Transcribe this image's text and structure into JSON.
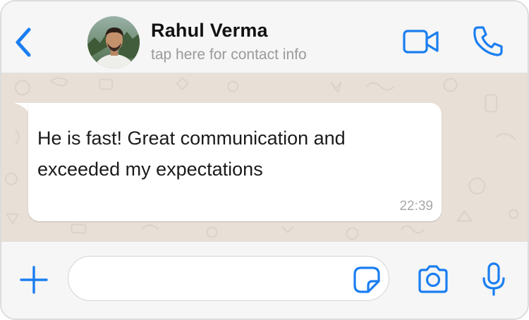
{
  "header": {
    "contact_name": "Rahul Verma",
    "subtitle": "tap here for contact info",
    "icons": {
      "back": "chevron-left-icon",
      "video": "video-camera-icon",
      "call": "phone-icon"
    }
  },
  "chat": {
    "messages": [
      {
        "direction": "incoming",
        "lines": [
          "He is fast! Great communication and",
          "exceeded my expectations"
        ],
        "time": "22:39"
      }
    ]
  },
  "composer": {
    "input_value": "",
    "icons": {
      "attach": "plus-icon",
      "sticker": "sticker-icon",
      "camera": "camera-icon",
      "mic": "microphone-icon"
    }
  },
  "colors": {
    "accent": "#1a7ef0",
    "chat_background": "#e8dfd6",
    "bubble": "#ffffff",
    "bar_background": "#f6f6f6"
  }
}
